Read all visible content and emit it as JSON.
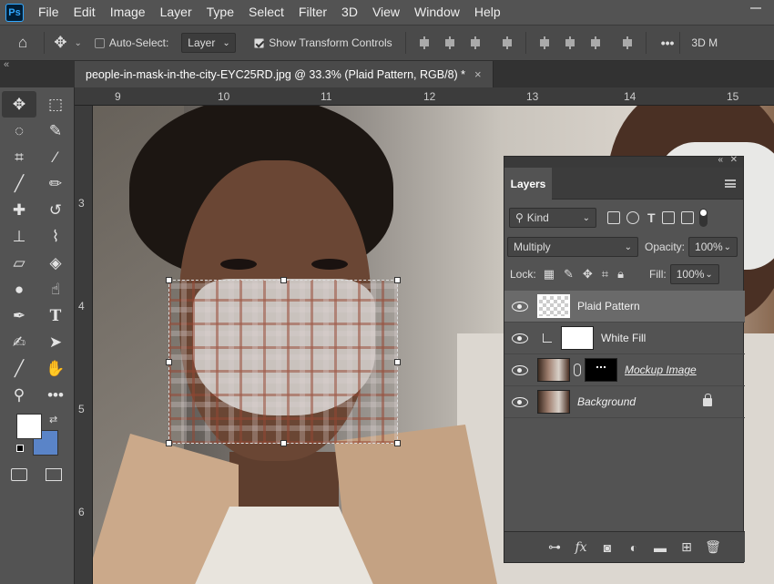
{
  "app": {
    "logo": "Ps"
  },
  "menu": [
    "File",
    "Edit",
    "Image",
    "Layer",
    "Type",
    "Select",
    "Filter",
    "3D",
    "View",
    "Window",
    "Help"
  ],
  "options": {
    "auto_select_label": "Auto-Select:",
    "auto_select_checked": false,
    "layer_dropdown": "Layer",
    "show_transform_label": "Show Transform Controls",
    "show_transform_checked": true,
    "more_label": "•••",
    "mode_3d_label": "3D M"
  },
  "document": {
    "tab_title": "people-in-mask-in-the-city-EYC25RD.jpg @ 33.3% (Plaid Pattern, RGB/8) *",
    "close_symbol": "×"
  },
  "rulers": {
    "top": [
      "9",
      "10",
      "11",
      "12",
      "13",
      "14",
      "15"
    ],
    "left": [
      "3",
      "4",
      "5",
      "6"
    ]
  },
  "colors": {
    "foreground": "#ffffff",
    "background": "#5a84c8",
    "accent": "#31a8ff"
  },
  "layers_panel": {
    "tab_label": "Layers",
    "filter_kind": "Kind",
    "blend_mode": "Multiply",
    "opacity_label": "Opacity:",
    "opacity_value": "100%",
    "lock_label": "Lock:",
    "fill_label": "Fill:",
    "fill_value": "100%",
    "layers": [
      {
        "name": "Plaid Pattern",
        "thumb": "transparent",
        "selected": true
      },
      {
        "name": "White Fill",
        "thumb": "white",
        "clipped": true
      },
      {
        "name": "Mockup Image",
        "thumb": "photo",
        "has_mask": true
      },
      {
        "name": "Background",
        "thumb": "photo",
        "locked": true
      }
    ],
    "footer_icons": [
      "link-icon",
      "fx-icon",
      "add-mask-icon",
      "adjustment-icon",
      "folder-icon",
      "new-layer-icon",
      "trash-icon"
    ]
  }
}
